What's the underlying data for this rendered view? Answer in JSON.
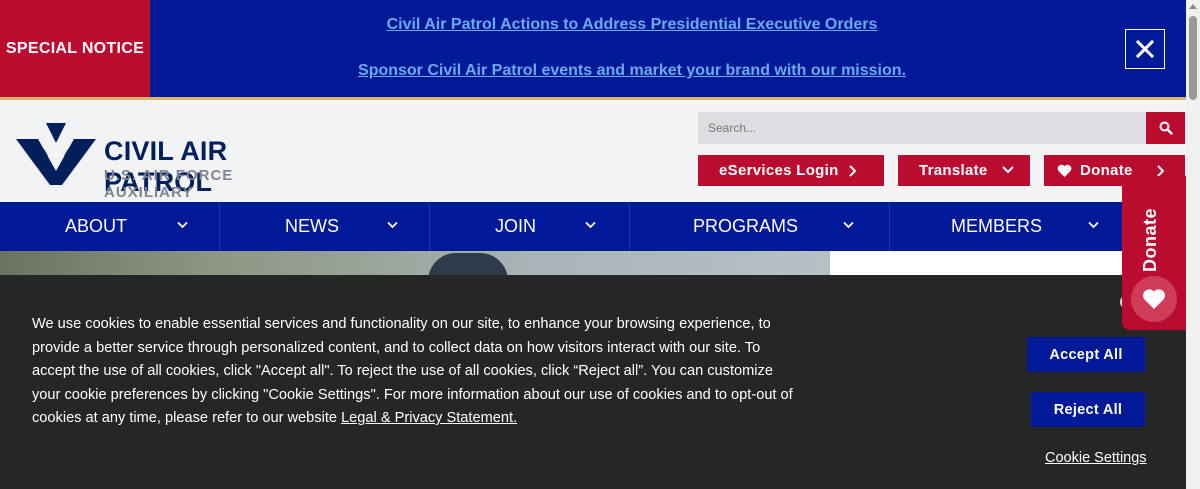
{
  "notice": {
    "label": "SPECIAL NOTICE",
    "link1": "Civil Air Patrol Actions to Address Presidential Executive Orders",
    "link2": "Sponsor Civil Air Patrol events and market your brand with our mission.",
    "close_icon": "close-icon"
  },
  "header": {
    "logo_title": "CIVIL AIR PATROL",
    "logo_subtitle": "U.S. AIR FORCE AUXILIARY",
    "search_placeholder": "Search...",
    "search_icon": "search-icon",
    "eservices_label": "eServices Login",
    "translate_label": "Translate",
    "donate_label": "Donate"
  },
  "nav": {
    "items": [
      {
        "label": "ABOUT"
      },
      {
        "label": "NEWS"
      },
      {
        "label": "JOIN"
      },
      {
        "label": "PROGRAMS"
      },
      {
        "label": "MEMBERS"
      }
    ]
  },
  "cookie": {
    "text": "We use cookies to enable essential services and functionality on our site, to enhance your browsing experience, to provide a better service through personalized content, and to collect data on how visitors interact with our site. To accept the use of all cookies, click \"Accept all\". To reject the use of all cookies, click “Reject all”. You can customize your cookie preferences by clicking \"Cookie Settings\". For more information about our use of cookies and to opt-out of cookies at any time, please refer to our website ",
    "link": "Legal & Privacy Statement.",
    "accept_label": "Accept All",
    "reject_label": "Reject All",
    "settings_label": "Cookie Settings"
  },
  "side_donate": {
    "label": "Donate"
  },
  "colors": {
    "navy": "#001996",
    "red": "#ba0c2f",
    "dark": "#262626",
    "link_blue": "#6ea9f0"
  }
}
